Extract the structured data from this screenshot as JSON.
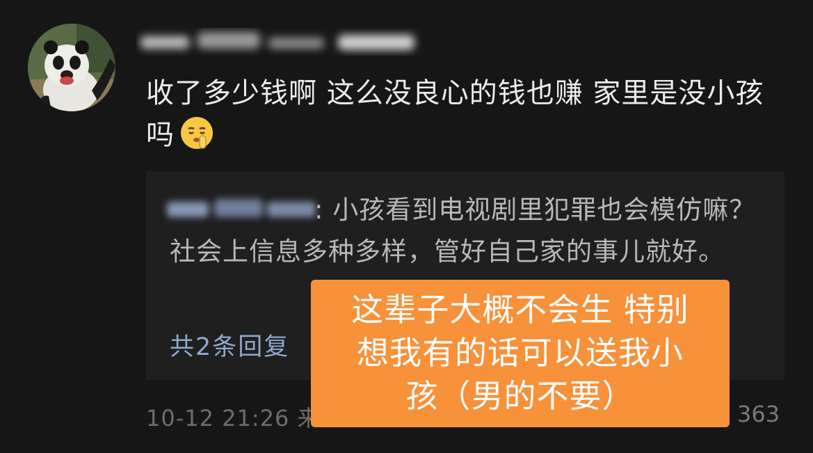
{
  "comment": {
    "text": "收了多少钱啊 这么没良心的钱也赚 家里是没小孩吗",
    "emoji": "shushing-face"
  },
  "reply": {
    "text": ": 小孩看到电视剧里犯罪也会模仿嘛？社会上信息多种多样，管好自己家的事儿就好。",
    "more_label": "共2条回复"
  },
  "meta": {
    "time_prefix": "10-12 21:26 来",
    "like_count": "363"
  },
  "overlay": {
    "line1": "这辈子大概不会生 特别",
    "line2": "想我有的话可以送我小",
    "line3": "孩（男的不要）"
  },
  "colors": {
    "background": "#161616",
    "reply_bg": "#1f1f1f",
    "link": "#8fa8cc",
    "overlay": "#f7913a"
  }
}
